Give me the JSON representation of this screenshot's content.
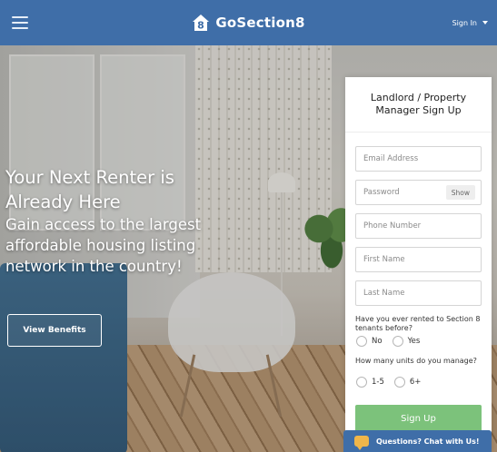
{
  "header": {
    "brand": "GoSection8",
    "signin_label": "Sign In",
    "colors": {
      "bar": "#3f6ea8",
      "accent_green": "#7cc27b",
      "chat_icon": "#f0b64a"
    }
  },
  "hero": {
    "title": "Your Next Renter is Already Here",
    "subtitle": "Gain access to the largest affordable housing listing network in the country!",
    "cta": "View Benefits"
  },
  "signup": {
    "title": "Landlord / Property Manager Sign Up",
    "email_placeholder": "Email Address",
    "password_placeholder": "Password",
    "show_label": "Show",
    "phone_placeholder": "Phone Number",
    "first_name_placeholder": "First Name",
    "last_name_placeholder": "Last Name",
    "q1": "Have you ever rented to Section 8 tenants before?",
    "q1_options": [
      "No",
      "Yes"
    ],
    "q2": "How many units do you manage?",
    "q2_options": [
      "1-5",
      "6+"
    ],
    "submit": "Sign Up"
  },
  "chat": {
    "label": "Questions? Chat with Us!"
  }
}
